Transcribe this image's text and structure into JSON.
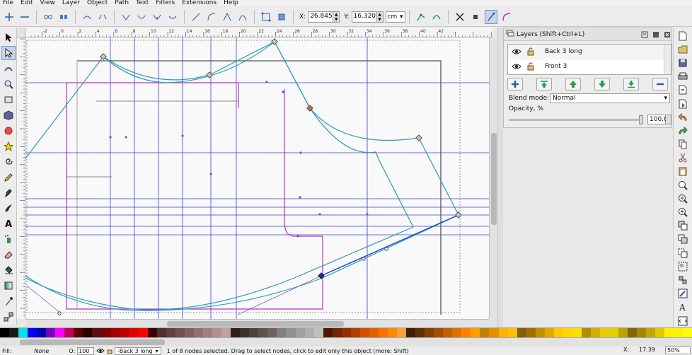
{
  "menu": [
    "File",
    "Edit",
    "View",
    "Layer",
    "Object",
    "Path",
    "Text",
    "Filters",
    "Extensions",
    "Help"
  ],
  "tool_controls": {
    "x_label": "X:",
    "x_value": "26.845",
    "y_label": "Y:",
    "y_value": "16.320",
    "unit": "cm"
  },
  "ruler_labels": [
    "-2",
    "0",
    "2",
    "4",
    "6",
    "8",
    "10",
    "12",
    "14",
    "16",
    "18",
    "20",
    "22",
    "24",
    "26",
    "28",
    "30",
    "32",
    "34",
    "36",
    "38",
    "40",
    "42"
  ],
  "layers_panel": {
    "title": "Layers (Shift+Ctrl+L)",
    "layers": [
      {
        "name": "Back 3 long",
        "visible": true,
        "locked": false
      },
      {
        "name": "Front 3",
        "visible": true,
        "locked": false
      }
    ],
    "blend_label": "Blend mode:",
    "blend_value": "Normal",
    "opacity_label": "Opacity, %",
    "opacity_value": "100.0",
    "opacity_fraction": 1.0
  },
  "palette": [
    "#000000",
    "#1a1a1a",
    "#00e5e5",
    "#0000ff",
    "#0000b0",
    "#7a00c0",
    "#ff00ff",
    "#c00060",
    "#600000",
    "#2a0000",
    "#5a1010",
    "#800000",
    "#a00000",
    "#c00000",
    "#e00000",
    "#ff0000",
    "#400000",
    "#503030",
    "#604040",
    "#705050",
    "#806060",
    "#907070",
    "#a08080",
    "#b09090",
    "#c0a0a0",
    "#302020",
    "#403030",
    "#504040",
    "#605050",
    "#706060",
    "#808080",
    "#909090",
    "#a0a0a0",
    "#b0b0b0",
    "#c0c0c0",
    "#501800",
    "#702800",
    "#903000",
    "#b04000",
    "#d05000",
    "#e06000",
    "#ff7000",
    "#ff8800",
    "#ffa040",
    "#402000",
    "#603000",
    "#804000",
    "#a05000",
    "#c06000",
    "#e07000",
    "#ff8000",
    "#ffa000",
    "#c08000",
    "#e09000",
    "#ffb000",
    "#ffc000",
    "#806000",
    "#a07000",
    "#c09000",
    "#e0a800",
    "#ffc800",
    "#ffd800",
    "#ffe000",
    "#b09000",
    "#d0b000",
    "#f0c800",
    "#e0d000",
    "#c0a000",
    "#806800",
    "#a08800",
    "#c0a800",
    "#e0c800",
    "#fff000",
    "#fff400",
    "#ffff00"
  ],
  "statusbar": {
    "fill_label": "Fill:",
    "fill_value": "None",
    "opacity_label": "O:",
    "opacity_value": "100",
    "layer": "-Back 3 long",
    "message": "1 of 8 nodes selected. Drag to select nodes, click to edit only this object (more: Shift)",
    "x_label": "X:",
    "x_value": "17.39",
    "zoom_value": "50%"
  }
}
